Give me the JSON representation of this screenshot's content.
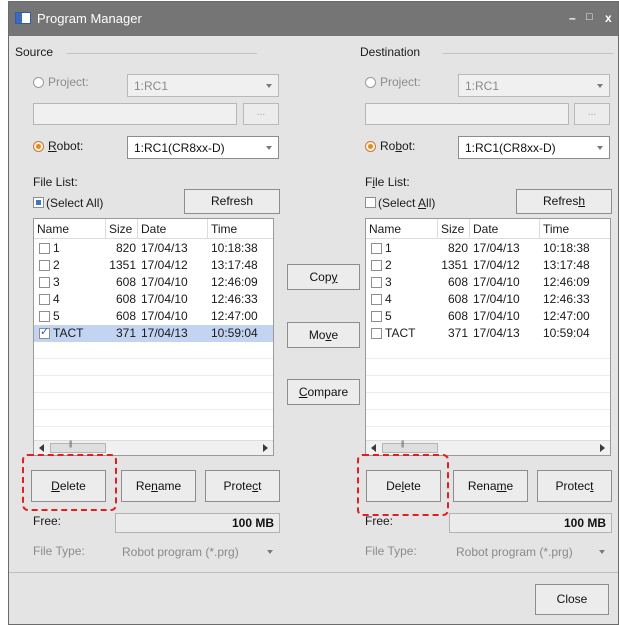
{
  "window": {
    "title": "Program Manager",
    "minimize": "–",
    "maximize": "□",
    "close": "x"
  },
  "source": {
    "group_title": "Source",
    "project_label": "Project:",
    "project_value": "1:RC1",
    "path_value": "",
    "browse_label": "...",
    "robot_label": "Robot:",
    "robot_value": "1:RC1(CR8xx-D)",
    "file_list_label": "File List:",
    "select_all_label": "(Select All)",
    "refresh_label": "Refresh",
    "columns": [
      "Name",
      "Size",
      "Date",
      "Time"
    ],
    "rows": [
      {
        "name": "1",
        "size": "820",
        "date": "17/04/13",
        "time": "10:18:38",
        "checked": false,
        "selected": false
      },
      {
        "name": "2",
        "size": "1351",
        "date": "17/04/12",
        "time": "13:17:48",
        "checked": false,
        "selected": false
      },
      {
        "name": "3",
        "size": "608",
        "date": "17/04/10",
        "time": "12:46:09",
        "checked": false,
        "selected": false
      },
      {
        "name": "4",
        "size": "608",
        "date": "17/04/10",
        "time": "12:46:33",
        "checked": false,
        "selected": false
      },
      {
        "name": "5",
        "size": "608",
        "date": "17/04/10",
        "time": "12:47:00",
        "checked": false,
        "selected": false
      },
      {
        "name": "TACT",
        "size": "371",
        "date": "17/04/13",
        "time": "10:59:04",
        "checked": true,
        "selected": true
      }
    ],
    "delete_label": "Delete",
    "rename_label": "Rename",
    "protect_label": "Protect",
    "free_label": "Free:",
    "free_value": "100 MB",
    "file_type_label": "File Type:",
    "file_type_value": "Robot program (*.prg)"
  },
  "destination": {
    "group_title": "Destination",
    "project_label": "Project:",
    "project_value": "1:RC1",
    "path_value": "",
    "browse_label": "...",
    "robot_label": "Robot:",
    "robot_value": "1:RC1(CR8xx-D)",
    "file_list_label": "File List:",
    "select_all_label": "(Select All)",
    "refresh_label": "Refresh",
    "columns": [
      "Name",
      "Size",
      "Date",
      "Time"
    ],
    "rows": [
      {
        "name": "1",
        "size": "820",
        "date": "17/04/13",
        "time": "10:18:38",
        "checked": false,
        "selected": false
      },
      {
        "name": "2",
        "size": "1351",
        "date": "17/04/12",
        "time": "13:17:48",
        "checked": false,
        "selected": false
      },
      {
        "name": "3",
        "size": "608",
        "date": "17/04/10",
        "time": "12:46:09",
        "checked": false,
        "selected": false
      },
      {
        "name": "4",
        "size": "608",
        "date": "17/04/10",
        "time": "12:46:33",
        "checked": false,
        "selected": false
      },
      {
        "name": "5",
        "size": "608",
        "date": "17/04/10",
        "time": "12:47:00",
        "checked": false,
        "selected": false
      },
      {
        "name": "TACT",
        "size": "371",
        "date": "17/04/13",
        "time": "10:59:04",
        "checked": false,
        "selected": false
      }
    ],
    "delete_label": "Delete",
    "rename_label": "Rename",
    "protect_label": "Protect",
    "free_label": "Free:",
    "free_value": "100 MB",
    "file_type_label": "File Type:",
    "file_type_value": "Robot program (*.prg)"
  },
  "middle": {
    "copy_label": "Copy",
    "move_label": "Move",
    "compare_label": "Compare"
  },
  "footer": {
    "close_label": "Close"
  },
  "colors": {
    "titlebar": "#757575",
    "selection": "#c3d3f2",
    "highlight": "#e02020",
    "radio_on": "#e8891c"
  }
}
